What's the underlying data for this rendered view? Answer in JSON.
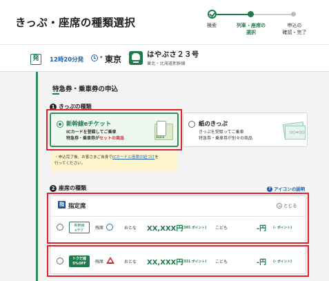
{
  "header": {
    "title": "きっぷ・座席の種類選択",
    "steps": [
      {
        "label": "検索"
      },
      {
        "label_line1": "列車・座席の",
        "label_line2": "選択"
      },
      {
        "label_line1": "申込の",
        "label_line2": "確認・完了"
      }
    ]
  },
  "train": {
    "dep_badge": "発",
    "dep_time": "12時20分発",
    "dep_station": "東京",
    "name": "はやぶさ２３号",
    "line": "東北・北海道新幹線"
  },
  "section": {
    "title": "特急券・乗車券の申込"
  },
  "ticket_type": {
    "heading_num": "1",
    "heading": "きっぷの種類",
    "options": [
      {
        "title": "新幹線eチケット",
        "desc_line1": "ICカードを登録してご乗車",
        "desc_line2_a": "特急券・乗車券が",
        "desc_line2_b": "セットの商品",
        "selected": true,
        "image_label": "Suica"
      },
      {
        "title": "紙のきっぷ",
        "desc_line1": "きっぷを受取ってご乗車",
        "desc_line2": "特急券・乗車券が別々の商品",
        "selected": false,
        "image_label": "○○+○○"
      }
    ],
    "notice_a": "・申込完了後、お客さまご自身で",
    "notice_link": "ICカードと座席の紐づけ",
    "notice_b": "を",
    "notice_c": "行ってください。"
  },
  "seat_type": {
    "heading_num": "2",
    "heading": "座席の種類",
    "help_icon": "?",
    "help": "アイコンの説明",
    "panel_icon": "指",
    "panel_label": "指定席",
    "close": "とじる",
    "rows": [
      {
        "badge_line1": "新幹線",
        "badge_line2": "eチケ",
        "seat_label": "残席",
        "availability": "circle",
        "adult_label": "おとな",
        "adult_price": "XX,XXX円",
        "adult_points": "(345 ポイント)",
        "child_label": "こども",
        "child_price": "-円",
        "child_points": "(- ポイント)"
      },
      {
        "badge_line1": "トクだ値",
        "badge_line2": "5%OFF",
        "seat_label": "残席",
        "availability": "triangle",
        "adult_label": "おとな",
        "adult_price": "XX,XXX円",
        "adult_points": "(331 ポイント)",
        "child_label": "こども",
        "child_price": "-円",
        "child_points": "(- ポイント)"
      }
    ]
  },
  "colors": {
    "brand_green": "#1f7a4d",
    "link_blue": "#1f5fa8",
    "highlight_red": "#e0202a",
    "notice_yellow": "#fff5cc"
  }
}
